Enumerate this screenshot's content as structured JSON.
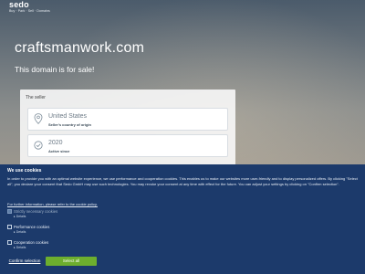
{
  "header": {
    "logo_text": "sedo",
    "logo_tagline": "Buy · Park · Sell · Domains"
  },
  "hero": {
    "domain": "craftsmanwork.com",
    "subtitle": "This domain is for sale!"
  },
  "seller": {
    "heading": "The seller",
    "cards": [
      {
        "icon": "location-pin-icon",
        "main": "United States",
        "sub": "Seller's country of origin"
      },
      {
        "icon": "checkmark-badge-icon",
        "main": "2020",
        "sub": "Active since"
      }
    ]
  },
  "cookies": {
    "title": "We use cookies",
    "text": "In order to provide you with an optimal website experience, we use performance and cooperation cookies. This enables us to make our websites more user-friendly and to display personalized offers. By clicking \"Select all\", you declare your consent that Sedo GmbH may use such technologies. You may revoke your consent at any time with effect for the future. You can adjust your settings by clicking on \"Confirm selection\".",
    "policy_link": "For further information, please refer to the cookie policy.",
    "categories": [
      {
        "label": "Strictly necessary cookies",
        "details": "▸ Details",
        "checked": true,
        "disabled": true
      },
      {
        "label": "Performance cookies",
        "details": "▸ Details",
        "checked": false,
        "disabled": false
      },
      {
        "label": "Cooperation cookies",
        "details": "▸ Details",
        "checked": false,
        "disabled": false
      }
    ],
    "confirm_label": "Confirm selection",
    "select_all_label": "Select all"
  },
  "colors": {
    "banner_bg": "#1c3a6b",
    "select_all_bg": "#6dae2e"
  }
}
